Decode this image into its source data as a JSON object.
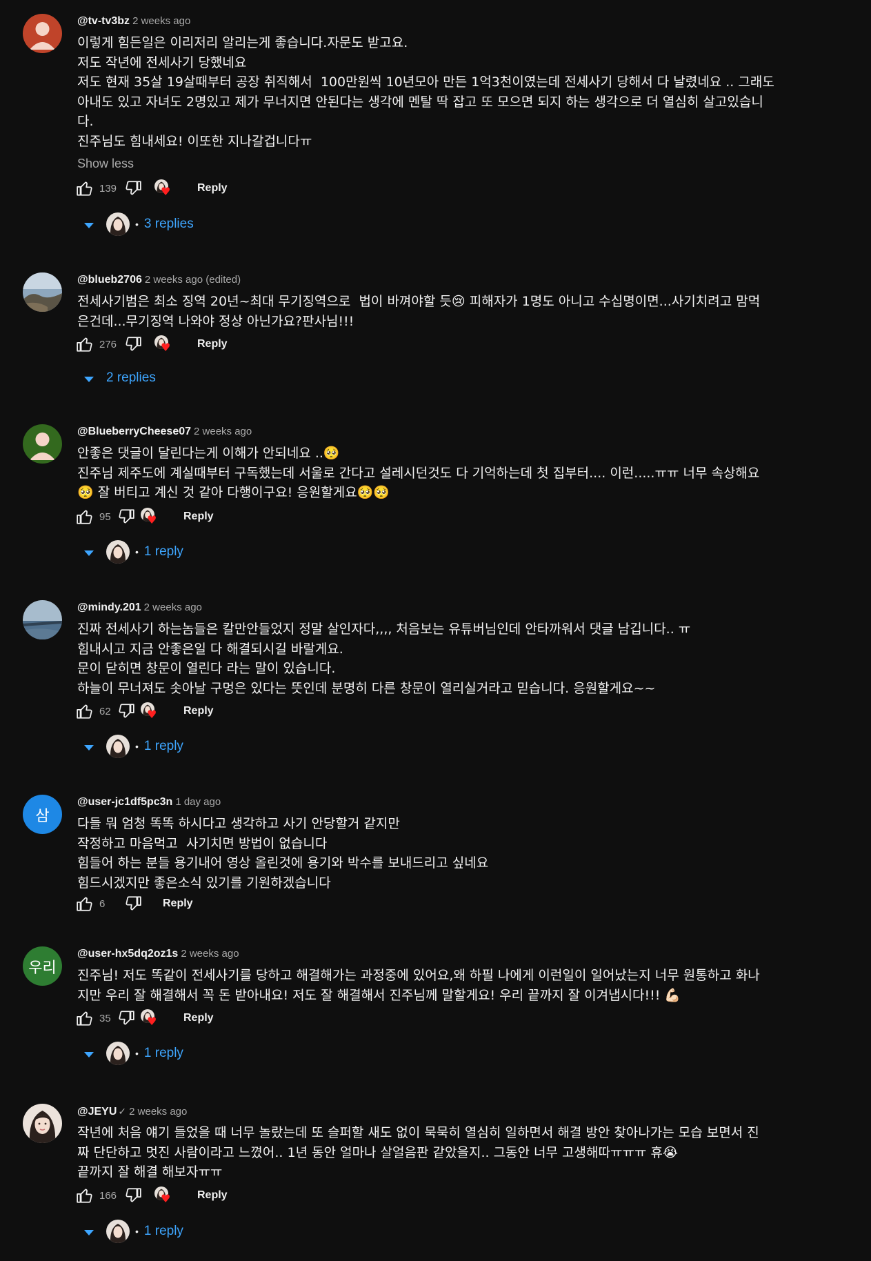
{
  "ui": {
    "show_less": "Show less",
    "reply_label": "Reply",
    "bullet": "•"
  },
  "colors": {
    "background": "#0f0f0f",
    "link_blue": "#3ea6ff",
    "heart_red": "#ff1f1f",
    "secondary_text": "#aaaaaa"
  },
  "comments": [
    {
      "handle": "@tv-tv3bz",
      "time": "2 weeks ago",
      "avatar": {
        "kind": "default-person",
        "color": "#c0442a"
      },
      "lines": [
        "이렇게 힘든일은 이리저리 알리는게 좋습니다.자문도 받고요.",
        "저도 작년에 전세사기 당했네요",
        "저도 현재 35살 19살때부터 공장 취직해서  100만원씩 10년모아 만든 1억3천이였는데 전세사기 당해서 다 날렸네요 .. 그래도",
        "아내도 있고 자녀도 2명있고 제가 무너지면 안된다는 생각에 멘탈 딱 잡고 또 모으면 되지 하는 생각으로 더 열심히 살고있습니",
        "다.",
        "진주님도 힘내세요! 이또한 지나갈겁니다ㅠ"
      ],
      "likes": "139",
      "replies_label": "3 replies"
    },
    {
      "handle": "@blueb2706",
      "time": "2 weeks ago (edited)",
      "avatar": {
        "kind": "photo-coast",
        "color": "#6f8fa8"
      },
      "lines": [
        "전세사기범은 최소 징역 20년~최대 무기징역으로  법이 바껴야할 듯😢 피해자가 1명도 아니고 수십명이면...사기치려고 맘먹",
        "은건데...무기징역 나와야 정상 아닌가요?판사님!!!"
      ],
      "likes": "276",
      "replies_label": "2 replies"
    },
    {
      "handle": "@BlueberryCheese07",
      "time": "2 weeks ago",
      "avatar": {
        "kind": "default-person",
        "color": "#33691e"
      },
      "lines": [
        "안좋은 댓글이 달린다는게 이해가 안되네요 ..🥺",
        "진주님 제주도에 계실때부터 구독했는데 서울로 간다고 설레시던것도 다 기억하는데 첫 집부터.... 이런.....ㅠㅠ 너무 속상해요",
        "🥺 잘 버티고 계신 것 같아 다행이구요! 응원할게요🥺🥺"
      ],
      "likes": "95",
      "replies_label": "1 reply"
    },
    {
      "handle": "@mindy.201",
      "time": "2 weeks ago",
      "avatar": {
        "kind": "photo-sea",
        "color": "#7f97ad"
      },
      "lines": [
        "진짜 전세사기 하는놈들은 칼만안들었지 정말 살인자다,,,, 처음보는 유튜버님인데 안타까워서 댓글 남깁니다.. ㅠ",
        "힘내시고 지금 안좋은일 다 해결되시길 바랄게요.",
        "문이 닫히면 창문이 열린다 라는 말이 있습니다.",
        "하늘이 무너져도 솟아날 구멍은 있다는 뜻인데 분명히 다른 창문이 열리실거라고 믿습니다. 응원할게요~~"
      ],
      "likes": "62",
      "replies_label": "1 reply"
    },
    {
      "handle": "@user-jc1df5pc3n",
      "time": "1 day ago",
      "avatar": {
        "kind": "letter",
        "letter": "삼",
        "color": "#1e88e5"
      },
      "lines": [
        "다들 뭐 엄청 똑똑 하시다고 생각하고 사기 안당할거 같지만",
        "작정하고 마음먹고  사기치면 방법이 없습니다",
        "힘들어 하는 분들 용기내어 영상 올린것에 용기와 박수를 보내드리고 싶네요",
        "힘드시겠지만 좋은소식 있기를 기원하겠습니다"
      ],
      "likes": "6",
      "replies_label": ""
    },
    {
      "handle": "@user-hx5dq2oz1s",
      "time": "2 weeks ago",
      "avatar": {
        "kind": "letter",
        "letter": "우리",
        "color": "#2e7d32"
      },
      "lines": [
        "진주님! 저도 똑같이 전세사기를 당하고 해결해가는 과정중에 있어요,왜 하필 나에게 이런일이 일어났는지 너무 원통하고 화나",
        "지만 우리 잘 해결해서 꼭 돈 받아내요! 저도 잘 해결해서 진주님께 말할게요! 우리 끝까지 잘 이겨냅시다!!! 💪🏻"
      ],
      "likes": "35",
      "replies_label": "1 reply"
    },
    {
      "handle": "@JEYU",
      "time": "2 weeks ago",
      "avatar": {
        "kind": "photo-woman",
        "color": "#e9dcd3"
      },
      "verified": true,
      "lines": [
        "작년에 처음 얘기 들었을 때 너무 놀랐는데 또 슬퍼할 새도 없이 묵묵히 열심히 일하면서 해결 방안 찾아나가는 모습 보면서 진",
        "짜 단단하고 멋진 사람이라고 느꼈어.. 1년 동안 얼마나 살얼음판 같았을지.. 그동안 너무 고생해따ㅠㅠㅠ 휴😭",
        "끝까지 잘 해결 해보자ㅠㅠ"
      ],
      "likes": "166",
      "replies_label": "1 reply"
    }
  ]
}
